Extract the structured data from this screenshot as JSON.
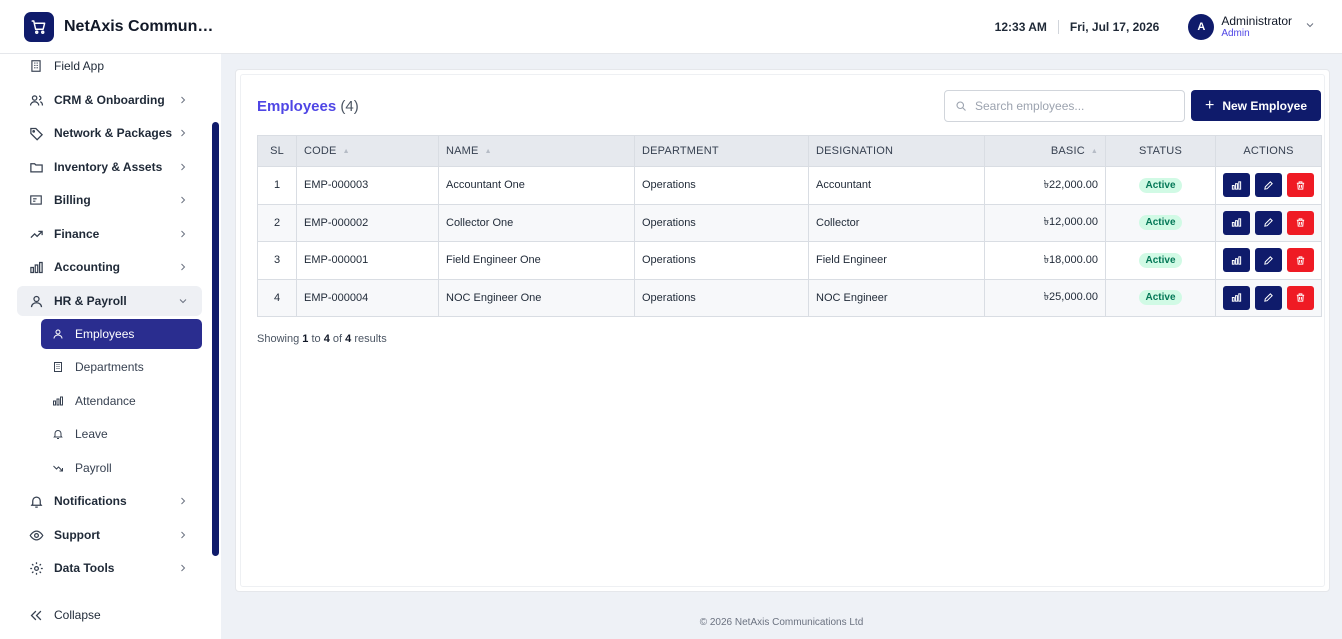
{
  "brand": {
    "name": "NetAxis Communications"
  },
  "header": {
    "time": "12:33 AM",
    "date": "Fri, Jul 17, 2026",
    "avatar_letter": "A",
    "user_name": "Administrator",
    "user_role": "Admin"
  },
  "sidebar": {
    "items": [
      {
        "label": "Field App",
        "icon": "building-icon"
      },
      {
        "label": "CRM & Onboarding",
        "icon": "users-icon"
      },
      {
        "label": "Network & Packages",
        "icon": "tag-icon"
      },
      {
        "label": "Inventory & Assets",
        "icon": "folder-icon"
      },
      {
        "label": "Billing",
        "icon": "invoice-icon"
      },
      {
        "label": "Finance",
        "icon": "trend-icon"
      },
      {
        "label": "Accounting",
        "icon": "bar-chart-icon"
      },
      {
        "label": "HR & Payroll",
        "icon": "person-icon"
      },
      {
        "label": "Notifications",
        "icon": "bell-icon"
      },
      {
        "label": "Support",
        "icon": "eye-icon"
      },
      {
        "label": "Data Tools",
        "icon": "gear-icon"
      }
    ],
    "sub_items": [
      {
        "label": "Employees",
        "icon": "person-icon"
      },
      {
        "label": "Departments",
        "icon": "building-icon"
      },
      {
        "label": "Attendance",
        "icon": "bar-chart-icon"
      },
      {
        "label": "Leave",
        "icon": "bell-icon"
      },
      {
        "label": "Payroll",
        "icon": "trend-down-icon"
      }
    ],
    "collapse_label": "Collapse"
  },
  "main": {
    "title": "Employees",
    "count": "(4)",
    "search_placeholder": "Search employees...",
    "new_button": "New Employee",
    "columns": [
      "SL",
      "CODE",
      "NAME",
      "DEPARTMENT",
      "DESIGNATION",
      "BASIC",
      "STATUS",
      "ACTIONS"
    ],
    "rows": [
      {
        "sl": "1",
        "code": "EMP-000003",
        "name": "Accountant One",
        "department": "Operations",
        "designation": "Accountant",
        "basic": "৳22,000.00",
        "status": "Active"
      },
      {
        "sl": "2",
        "code": "EMP-000002",
        "name": "Collector One",
        "department": "Operations",
        "designation": "Collector",
        "basic": "৳12,000.00",
        "status": "Active"
      },
      {
        "sl": "3",
        "code": "EMP-000001",
        "name": "Field Engineer One",
        "department": "Operations",
        "designation": "Field Engineer",
        "basic": "৳18,000.00",
        "status": "Active"
      },
      {
        "sl": "4",
        "code": "EMP-000004",
        "name": "NOC Engineer One",
        "department": "Operations",
        "designation": "NOC Engineer",
        "basic": "৳25,000.00",
        "status": "Active"
      }
    ],
    "showing": {
      "prefix": "Showing",
      "from": "1",
      "to_word": "to",
      "to": "4",
      "of_word": "of",
      "total": "4",
      "suffix": "results"
    }
  },
  "footer": {
    "text": "© 2026 NetAxis Communications Ltd"
  },
  "colors": {
    "brand": "#0f1b6b",
    "accent": "#4f46e5",
    "active_nav": "#2a2d8f",
    "danger": "#ef1b24",
    "success_bg": "#d1fae5",
    "success_text": "#047857"
  }
}
